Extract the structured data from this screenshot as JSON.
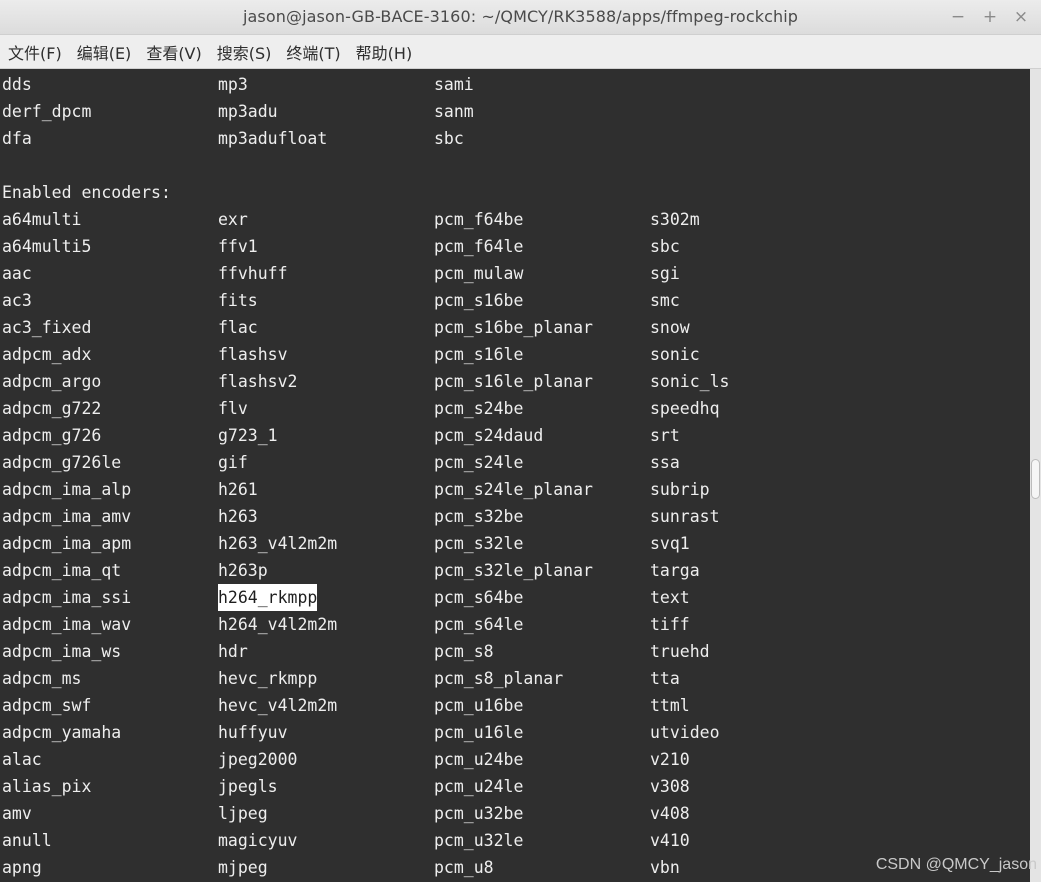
{
  "window": {
    "title": "jason@jason-GB-BACE-3160: ~/QMCY/RK3588/apps/ffmpeg-rockchip",
    "minimize": "−",
    "maximize": "+",
    "close": "×"
  },
  "menu": [
    "文件(F)",
    "编辑(E)",
    "查看(V)",
    "搜索(S)",
    "终端(T)",
    "帮助(H)"
  ],
  "terminal": {
    "lines": [
      [
        "dds",
        "mp3",
        "sami",
        ""
      ],
      [
        "derf_dpcm",
        "mp3adu",
        "sanm",
        ""
      ],
      [
        "dfa",
        "mp3adufloat",
        "sbc",
        ""
      ],
      [
        "",
        "",
        "",
        ""
      ],
      [
        "Enabled encoders:",
        "",
        "",
        ""
      ],
      [
        "a64multi",
        "exr",
        "pcm_f64be",
        "s302m"
      ],
      [
        "a64multi5",
        "ffv1",
        "pcm_f64le",
        "sbc"
      ],
      [
        "aac",
        "ffvhuff",
        "pcm_mulaw",
        "sgi"
      ],
      [
        "ac3",
        "fits",
        "pcm_s16be",
        "smc"
      ],
      [
        "ac3_fixed",
        "flac",
        "pcm_s16be_planar",
        "snow"
      ],
      [
        "adpcm_adx",
        "flashsv",
        "pcm_s16le",
        "sonic"
      ],
      [
        "adpcm_argo",
        "flashsv2",
        "pcm_s16le_planar",
        "sonic_ls"
      ],
      [
        "adpcm_g722",
        "flv",
        "pcm_s24be",
        "speedhq"
      ],
      [
        "adpcm_g726",
        "g723_1",
        "pcm_s24daud",
        "srt"
      ],
      [
        "adpcm_g726le",
        "gif",
        "pcm_s24le",
        "ssa"
      ],
      [
        "adpcm_ima_alp",
        "h261",
        "pcm_s24le_planar",
        "subrip"
      ],
      [
        "adpcm_ima_amv",
        "h263",
        "pcm_s32be",
        "sunrast"
      ],
      [
        "adpcm_ima_apm",
        "h263_v4l2m2m",
        "pcm_s32le",
        "svq1"
      ],
      [
        "adpcm_ima_qt",
        "h263p",
        "pcm_s32le_planar",
        "targa"
      ],
      [
        "adpcm_ima_ssi",
        "h264_rkmpp",
        "pcm_s64be",
        "text"
      ],
      [
        "adpcm_ima_wav",
        "h264_v4l2m2m",
        "pcm_s64le",
        "tiff"
      ],
      [
        "adpcm_ima_ws",
        "hdr",
        "pcm_s8",
        "truehd"
      ],
      [
        "adpcm_ms",
        "hevc_rkmpp",
        "pcm_s8_planar",
        "tta"
      ],
      [
        "adpcm_swf",
        "hevc_v4l2m2m",
        "pcm_u16be",
        "ttml"
      ],
      [
        "adpcm_yamaha",
        "huffyuv",
        "pcm_u16le",
        "utvideo"
      ],
      [
        "alac",
        "jpeg2000",
        "pcm_u24be",
        "v210"
      ],
      [
        "alias_pix",
        "jpegls",
        "pcm_u24le",
        "v308"
      ],
      [
        "amv",
        "ljpeg",
        "pcm_u32be",
        "v408"
      ],
      [
        "anull",
        "magicyuv",
        "pcm_u32le",
        "v410"
      ],
      [
        "apng",
        "mjpeg",
        "pcm_u8",
        "vbn"
      ]
    ],
    "selected": "h264_rkmpp",
    "colors": {
      "background": "#2f2f2f",
      "text": "#eeeeee",
      "selection_background": "#ffffff",
      "selection_text": "#1e1e1e"
    }
  },
  "watermark": "CSDN @QMCY_jason"
}
